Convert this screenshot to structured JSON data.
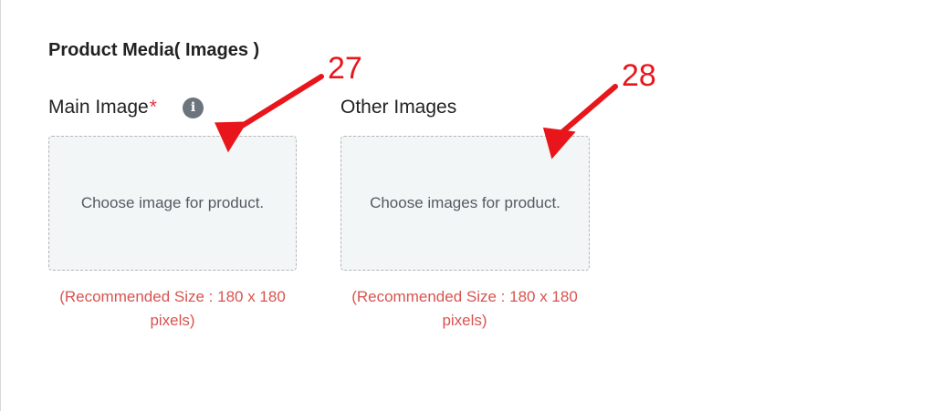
{
  "section": {
    "title": "Product Media( Images )"
  },
  "main_image": {
    "label": "Main Image",
    "required_marker": "*",
    "info_icon": "info-icon",
    "dropzone_text": "Choose image for product.",
    "hint": "(Recommended Size : 180 x 180 pixels)"
  },
  "other_images": {
    "label": "Other Images",
    "dropzone_text": "Choose images for product.",
    "hint": "(Recommended Size : 180 x 180 pixels)"
  },
  "annotations": [
    {
      "number": "27"
    },
    {
      "number": "28"
    }
  ],
  "colors": {
    "annotation": "#e8161b",
    "required": "#dc3545",
    "hint": "#d9534f",
    "dropzone_bg": "#f3f6f7",
    "info_icon_bg": "#6c757d"
  }
}
